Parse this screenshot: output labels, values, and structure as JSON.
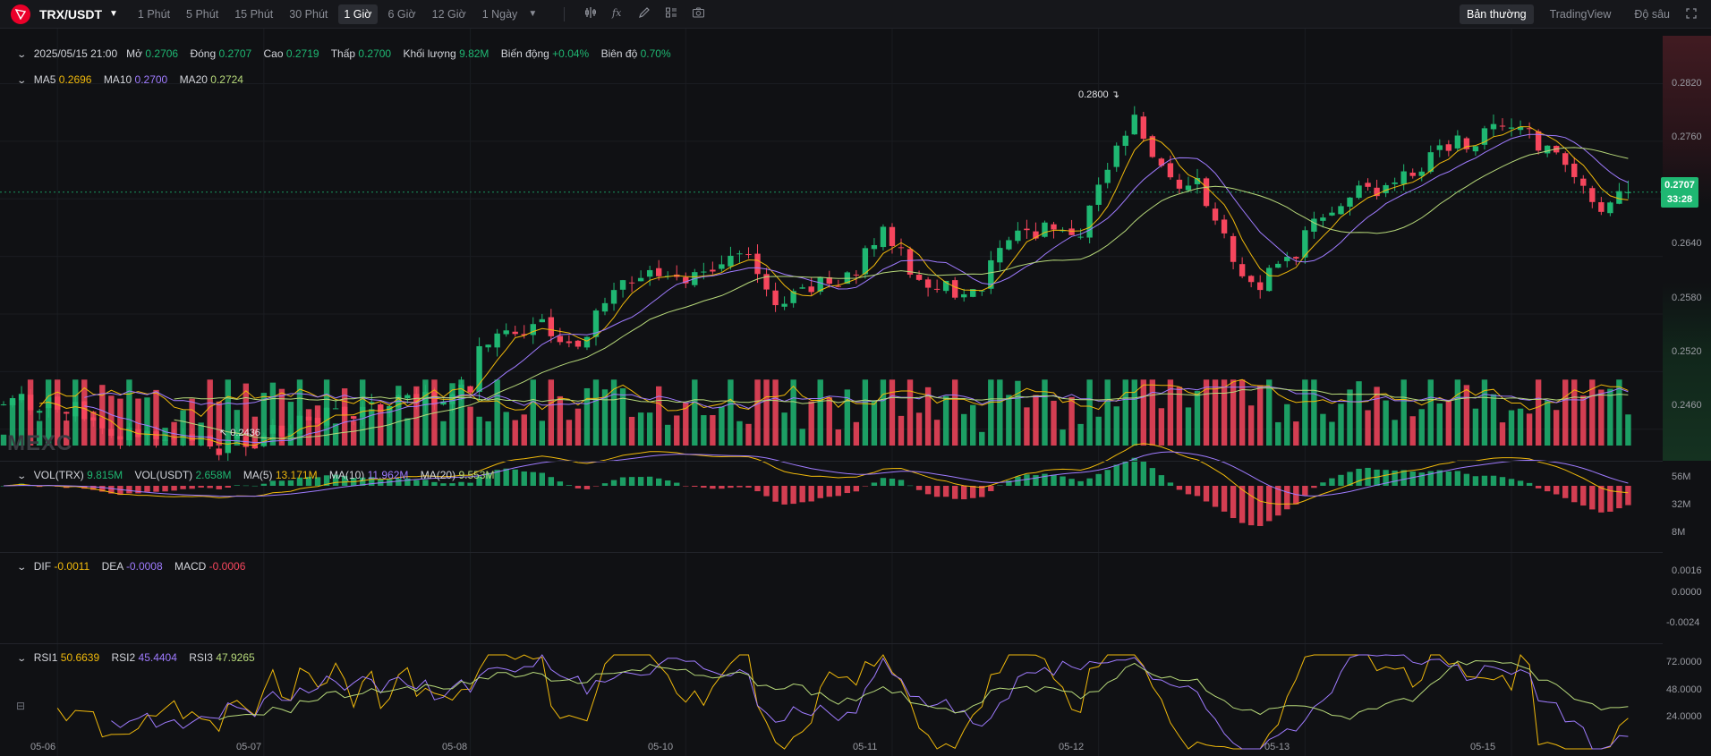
{
  "toolbar": {
    "symbol": "TRX/USDT",
    "timeframes": [
      "1 Phút",
      "5 Phút",
      "15 Phút",
      "30 Phút",
      "1 Giờ",
      "6 Giờ",
      "12 Giờ",
      "1 Ngày"
    ],
    "active_timeframe": "1 Giờ",
    "tools": [
      "indicator-icon",
      "formula-icon",
      "draw-icon",
      "layout-icon",
      "camera-icon"
    ],
    "views": [
      "Bản thường",
      "TradingView",
      "Độ sâu"
    ],
    "active_view": "Bản thường"
  },
  "ohlc": {
    "date": "2025/05/15 21:00",
    "open_label": "Mở",
    "open": "0.2706",
    "close_label": "Đóng",
    "close": "0.2707",
    "high_label": "Cao",
    "high": "0.2719",
    "low_label": "Thấp",
    "low": "0.2700",
    "volume_label": "Khối lượng",
    "volume": "9.82M",
    "change_label": "Biến động",
    "change": "+0.04%",
    "amplitude_label": "Biên độ",
    "amplitude": "0.70%"
  },
  "ma_legend": {
    "ma5_label": "MA5",
    "ma5": "0.2696",
    "ma10_label": "MA10",
    "ma10": "0.2700",
    "ma20_label": "MA20",
    "ma20": "0.2724"
  },
  "vol_legend": {
    "vol_trx_label": "VOL(TRX)",
    "vol_trx": "9.815M",
    "vol_usdt_label": "VOL(USDT)",
    "vol_usdt": "2.658M",
    "ma5_label": "MA(5)",
    "ma5": "13.171M",
    "ma10_label": "MA(10)",
    "ma10": "11.962M",
    "ma20_label": "MA(20)",
    "ma20": "9.553M"
  },
  "macd_legend": {
    "dif_label": "DIF",
    "dif": "-0.0011",
    "dea_label": "DEA",
    "dea": "-0.0008",
    "macd_label": "MACD",
    "macd": "-0.0006"
  },
  "rsi_legend": {
    "rsi1_label": "RSI1",
    "rsi1": "50.6639",
    "rsi2_label": "RSI2",
    "rsi2": "45.4404",
    "rsi3_label": "RSI3",
    "rsi3": "47.9265"
  },
  "current_price": {
    "price": "0.2707",
    "countdown": "33:28"
  },
  "annotations": {
    "high_mark": "0.2800",
    "low_mark": "0.2436"
  },
  "watermark": "MEXC",
  "colors": {
    "up": "#1fb772",
    "down": "#f6465d",
    "ma5": "#f0b90b",
    "ma10": "#9f7bff",
    "ma20": "#b7d97a"
  },
  "chart_data": {
    "type": "candlestick",
    "price_axis": {
      "ticks": [
        0.282,
        0.276,
        0.27,
        0.264,
        0.258,
        0.252,
        0.246
      ],
      "range": [
        0.243,
        0.284
      ]
    },
    "price_tick_labels": [
      "0.2820",
      "0.2760",
      "0.2640",
      "0.2580",
      "0.2520",
      "0.2460"
    ],
    "volume_axis_labels": [
      "56M",
      "32M",
      "8M"
    ],
    "volume_ticks": [
      56,
      32,
      8
    ],
    "volume_range": [
      0,
      66
    ],
    "macd_axis_labels": [
      "0.0016",
      "0.0000",
      "-0.0024"
    ],
    "macd_ticks": [
      0.0016,
      0.0,
      -0.0024
    ],
    "macd_range": [
      -0.0034,
      0.003
    ],
    "rsi_axis_labels": [
      "72.0000",
      "48.0000",
      "24.0000"
    ],
    "rsi_ticks": [
      72,
      48,
      24
    ],
    "rsi_range": [
      12,
      88
    ],
    "x_labels": [
      "05-06",
      "05-07",
      "05-08",
      "05-10",
      "05-11",
      "05-12",
      "05-13",
      "05-15"
    ],
    "x_label_index": [
      6,
      29,
      52,
      76,
      99,
      122,
      145,
      168
    ],
    "candle_count": 182,
    "close_anchors": [
      [
        0,
        0.249
      ],
      [
        8,
        0.248
      ],
      [
        14,
        0.2455
      ],
      [
        20,
        0.2462
      ],
      [
        24,
        0.244
      ],
      [
        28,
        0.2448
      ],
      [
        34,
        0.247
      ],
      [
        40,
        0.2478
      ],
      [
        46,
        0.2492
      ],
      [
        52,
        0.2505
      ],
      [
        53,
        0.2545
      ],
      [
        58,
        0.2565
      ],
      [
        60,
        0.257
      ],
      [
        64,
        0.2548
      ],
      [
        68,
        0.261
      ],
      [
        72,
        0.2625
      ],
      [
        76,
        0.2608
      ],
      [
        80,
        0.2635
      ],
      [
        84,
        0.2632
      ],
      [
        86,
        0.26
      ],
      [
        90,
        0.2605
      ],
      [
        94,
        0.2615
      ],
      [
        98,
        0.2665
      ],
      [
        101,
        0.263
      ],
      [
        104,
        0.261
      ],
      [
        108,
        0.26
      ],
      [
        112,
        0.2655
      ],
      [
        116,
        0.2665
      ],
      [
        120,
        0.266
      ],
      [
        122,
        0.272
      ],
      [
        126,
        0.279
      ],
      [
        128,
        0.2745
      ],
      [
        131,
        0.27
      ],
      [
        133,
        0.272
      ],
      [
        136,
        0.266
      ],
      [
        138,
        0.262
      ],
      [
        140,
        0.2615
      ],
      [
        144,
        0.2648
      ],
      [
        148,
        0.269
      ],
      [
        152,
        0.271
      ],
      [
        156,
        0.2722
      ],
      [
        160,
        0.275
      ],
      [
        164,
        0.276
      ],
      [
        168,
        0.2775
      ],
      [
        170,
        0.2765
      ],
      [
        174,
        0.273
      ],
      [
        178,
        0.269
      ],
      [
        181,
        0.2707
      ]
    ],
    "ohlc_last": {
      "open": 0.2706,
      "high": 0.2719,
      "low": 0.27,
      "close": 0.2707
    }
  }
}
